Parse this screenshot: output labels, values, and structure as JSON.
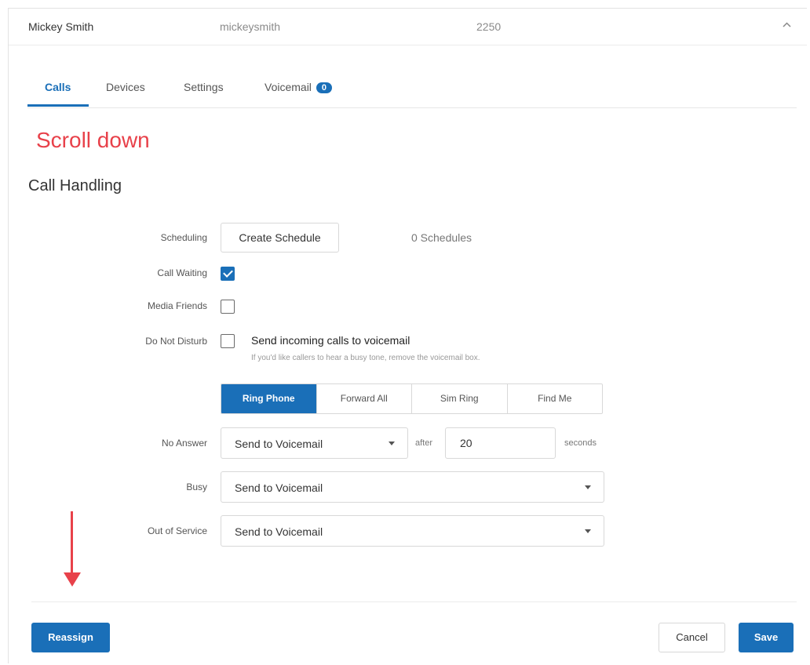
{
  "user_row": {
    "name": "Mickey Smith",
    "username": "mickeysmith",
    "extension": "2250",
    "collapse_icon": "chevron-up-icon"
  },
  "tabs": [
    {
      "label": "Calls",
      "active": true
    },
    {
      "label": "Devices"
    },
    {
      "label": "Settings"
    },
    {
      "label": "Voicemail",
      "badge": "0"
    }
  ],
  "annotation": {
    "text": "Scroll down",
    "color": "#e8414a"
  },
  "section": {
    "title": "Call Handling"
  },
  "form": {
    "scheduling": {
      "label": "Scheduling",
      "button": "Create Schedule",
      "count_text": "0 Schedules"
    },
    "call_waiting": {
      "label": "Call Waiting",
      "checked": true
    },
    "media_friends": {
      "label": "Media Friends",
      "checked": false
    },
    "do_not_disturb": {
      "label": "Do Not Disturb",
      "checked": false,
      "option_title": "Send incoming calls to voicemail",
      "help": "If you'd like callers to hear a busy tone, remove the voicemail box."
    },
    "mode_tabs": [
      {
        "label": "Ring Phone",
        "active": true
      },
      {
        "label": "Forward All"
      },
      {
        "label": "Sim Ring"
      },
      {
        "label": "Find Me"
      }
    ],
    "no_answer": {
      "label": "No Answer",
      "value": "Send to Voicemail",
      "after": "after",
      "seconds_value": "20",
      "seconds_label": "seconds"
    },
    "busy": {
      "label": "Busy",
      "value": "Send to Voicemail"
    },
    "out_of_service": {
      "label": "Out of Service",
      "value": "Send to Voicemail"
    }
  },
  "footer": {
    "reassign": "Reassign",
    "cancel": "Cancel",
    "save": "Save"
  },
  "colors": {
    "accent": "#1a6fb8",
    "annotation": "#e8414a"
  }
}
